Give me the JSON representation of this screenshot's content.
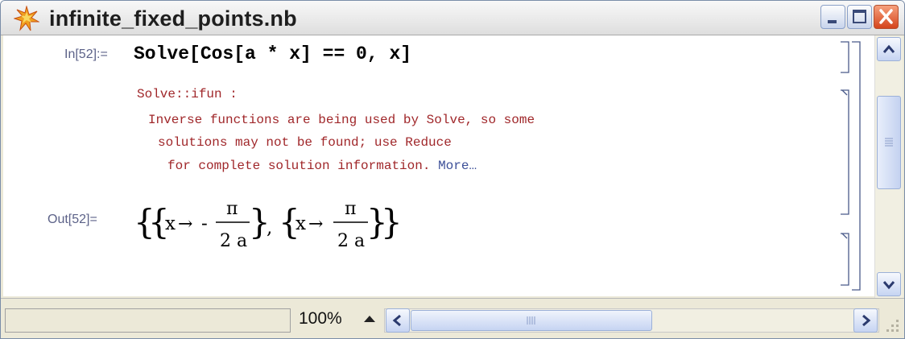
{
  "window": {
    "title": "infinite_fixed_points.nb",
    "controls": [
      "minimize-icon",
      "maximize-icon",
      "close-icon"
    ]
  },
  "notebook": {
    "input": {
      "label": "In[52]:=",
      "code": "Solve[Cos[a * x] == 0, x]"
    },
    "message": {
      "tag": "Solve::ifun :",
      "line1": "Inverse functions are being used by Solve, so some",
      "line2": "solutions may not be found; use Reduce",
      "line3": "for complete solution information.",
      "more_link": "More…"
    },
    "output": {
      "label": "Out[52]=",
      "var": "x",
      "arrow": "→",
      "minus": "-",
      "numerator": "π",
      "denominator": "2 a",
      "separator": ","
    }
  },
  "statusbar": {
    "zoom": "100%"
  },
  "colors": {
    "message_text": "#a0272a",
    "more_link": "#3c4f98",
    "cell_label": "#5c6288",
    "close_button": "#d4441c"
  }
}
